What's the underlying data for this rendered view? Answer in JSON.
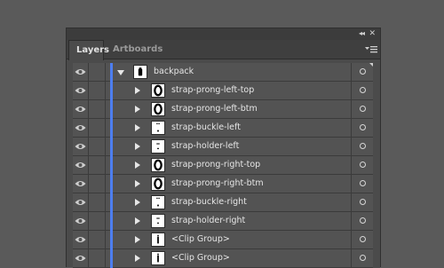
{
  "panel": {
    "collapse_glyph": "◂◂",
    "close_glyph": "✕",
    "tabs": [
      {
        "label": "Layers",
        "active": true
      },
      {
        "label": "Artboards",
        "active": false
      }
    ]
  },
  "layer_color": "#4d7ef0",
  "rows": [
    {
      "label": "backpack",
      "expanded": true,
      "level": 0,
      "thumb": "trash-glyph"
    },
    {
      "label": "strap-prong-left-top",
      "expanded": false,
      "level": 1,
      "thumb": "ring"
    },
    {
      "label": "strap-prong-left-btm",
      "expanded": false,
      "level": 1,
      "thumb": "ring"
    },
    {
      "label": "strap-buckle-left",
      "expanded": false,
      "level": 1,
      "thumb": "dots"
    },
    {
      "label": "strap-holder-left",
      "expanded": false,
      "level": 1,
      "thumb": "dash"
    },
    {
      "label": "strap-prong-right-top",
      "expanded": false,
      "level": 1,
      "thumb": "ring"
    },
    {
      "label": "strap-prong-right-btm",
      "expanded": false,
      "level": 1,
      "thumb": "ring"
    },
    {
      "label": "strap-buckle-right",
      "expanded": false,
      "level": 1,
      "thumb": "dots"
    },
    {
      "label": "strap-holder-right",
      "expanded": false,
      "level": 1,
      "thumb": "dash"
    },
    {
      "label": "<Clip Group>",
      "expanded": false,
      "level": 1,
      "thumb": "bar"
    },
    {
      "label": "<Clip Group>",
      "expanded": false,
      "level": 1,
      "thumb": "bar"
    }
  ]
}
